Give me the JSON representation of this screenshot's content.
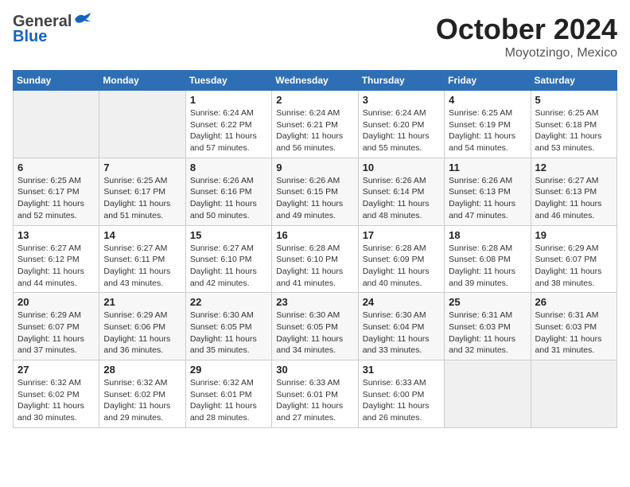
{
  "header": {
    "logo_general": "General",
    "logo_blue": "Blue",
    "title": "October 2024",
    "subtitle": "Moyotzingo, Mexico"
  },
  "weekdays": [
    "Sunday",
    "Monday",
    "Tuesday",
    "Wednesday",
    "Thursday",
    "Friday",
    "Saturday"
  ],
  "weeks": [
    [
      {
        "day": "",
        "detail": ""
      },
      {
        "day": "",
        "detail": ""
      },
      {
        "day": "1",
        "detail": "Sunrise: 6:24 AM\nSunset: 6:22 PM\nDaylight: 11 hours and 57 minutes."
      },
      {
        "day": "2",
        "detail": "Sunrise: 6:24 AM\nSunset: 6:21 PM\nDaylight: 11 hours and 56 minutes."
      },
      {
        "day": "3",
        "detail": "Sunrise: 6:24 AM\nSunset: 6:20 PM\nDaylight: 11 hours and 55 minutes."
      },
      {
        "day": "4",
        "detail": "Sunrise: 6:25 AM\nSunset: 6:19 PM\nDaylight: 11 hours and 54 minutes."
      },
      {
        "day": "5",
        "detail": "Sunrise: 6:25 AM\nSunset: 6:18 PM\nDaylight: 11 hours and 53 minutes."
      }
    ],
    [
      {
        "day": "6",
        "detail": "Sunrise: 6:25 AM\nSunset: 6:17 PM\nDaylight: 11 hours and 52 minutes."
      },
      {
        "day": "7",
        "detail": "Sunrise: 6:25 AM\nSunset: 6:17 PM\nDaylight: 11 hours and 51 minutes."
      },
      {
        "day": "8",
        "detail": "Sunrise: 6:26 AM\nSunset: 6:16 PM\nDaylight: 11 hours and 50 minutes."
      },
      {
        "day": "9",
        "detail": "Sunrise: 6:26 AM\nSunset: 6:15 PM\nDaylight: 11 hours and 49 minutes."
      },
      {
        "day": "10",
        "detail": "Sunrise: 6:26 AM\nSunset: 6:14 PM\nDaylight: 11 hours and 48 minutes."
      },
      {
        "day": "11",
        "detail": "Sunrise: 6:26 AM\nSunset: 6:13 PM\nDaylight: 11 hours and 47 minutes."
      },
      {
        "day": "12",
        "detail": "Sunrise: 6:27 AM\nSunset: 6:13 PM\nDaylight: 11 hours and 46 minutes."
      }
    ],
    [
      {
        "day": "13",
        "detail": "Sunrise: 6:27 AM\nSunset: 6:12 PM\nDaylight: 11 hours and 44 minutes."
      },
      {
        "day": "14",
        "detail": "Sunrise: 6:27 AM\nSunset: 6:11 PM\nDaylight: 11 hours and 43 minutes."
      },
      {
        "day": "15",
        "detail": "Sunrise: 6:27 AM\nSunset: 6:10 PM\nDaylight: 11 hours and 42 minutes."
      },
      {
        "day": "16",
        "detail": "Sunrise: 6:28 AM\nSunset: 6:10 PM\nDaylight: 11 hours and 41 minutes."
      },
      {
        "day": "17",
        "detail": "Sunrise: 6:28 AM\nSunset: 6:09 PM\nDaylight: 11 hours and 40 minutes."
      },
      {
        "day": "18",
        "detail": "Sunrise: 6:28 AM\nSunset: 6:08 PM\nDaylight: 11 hours and 39 minutes."
      },
      {
        "day": "19",
        "detail": "Sunrise: 6:29 AM\nSunset: 6:07 PM\nDaylight: 11 hours and 38 minutes."
      }
    ],
    [
      {
        "day": "20",
        "detail": "Sunrise: 6:29 AM\nSunset: 6:07 PM\nDaylight: 11 hours and 37 minutes."
      },
      {
        "day": "21",
        "detail": "Sunrise: 6:29 AM\nSunset: 6:06 PM\nDaylight: 11 hours and 36 minutes."
      },
      {
        "day": "22",
        "detail": "Sunrise: 6:30 AM\nSunset: 6:05 PM\nDaylight: 11 hours and 35 minutes."
      },
      {
        "day": "23",
        "detail": "Sunrise: 6:30 AM\nSunset: 6:05 PM\nDaylight: 11 hours and 34 minutes."
      },
      {
        "day": "24",
        "detail": "Sunrise: 6:30 AM\nSunset: 6:04 PM\nDaylight: 11 hours and 33 minutes."
      },
      {
        "day": "25",
        "detail": "Sunrise: 6:31 AM\nSunset: 6:03 PM\nDaylight: 11 hours and 32 minutes."
      },
      {
        "day": "26",
        "detail": "Sunrise: 6:31 AM\nSunset: 6:03 PM\nDaylight: 11 hours and 31 minutes."
      }
    ],
    [
      {
        "day": "27",
        "detail": "Sunrise: 6:32 AM\nSunset: 6:02 PM\nDaylight: 11 hours and 30 minutes."
      },
      {
        "day": "28",
        "detail": "Sunrise: 6:32 AM\nSunset: 6:02 PM\nDaylight: 11 hours and 29 minutes."
      },
      {
        "day": "29",
        "detail": "Sunrise: 6:32 AM\nSunset: 6:01 PM\nDaylight: 11 hours and 28 minutes."
      },
      {
        "day": "30",
        "detail": "Sunrise: 6:33 AM\nSunset: 6:01 PM\nDaylight: 11 hours and 27 minutes."
      },
      {
        "day": "31",
        "detail": "Sunrise: 6:33 AM\nSunset: 6:00 PM\nDaylight: 11 hours and 26 minutes."
      },
      {
        "day": "",
        "detail": ""
      },
      {
        "day": "",
        "detail": ""
      }
    ]
  ]
}
